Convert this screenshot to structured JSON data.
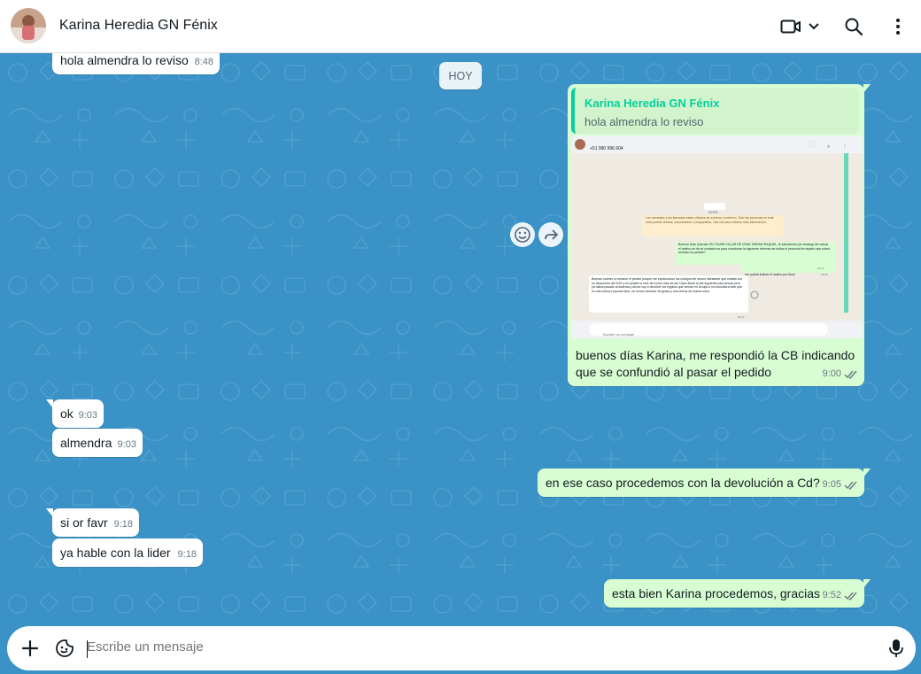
{
  "header": {
    "contact_name": "Karina Heredia GN Fénix",
    "icons": [
      "video-call-icon",
      "chevron-down-icon",
      "search-icon",
      "menu-icon"
    ]
  },
  "chat": {
    "date_chip": "HOY",
    "messages": [
      {
        "dir": "in",
        "text": "hola almendra lo reviso",
        "time": "8:48"
      },
      {
        "dir": "out",
        "quote": {
          "name": "Karina Heredia GN Fénix",
          "text": "hola almendra lo reviso"
        },
        "text_line1": "buenos días Karina, me respondió la CB indicando",
        "text_line2": "que se confundió al pasar el pedido",
        "time": "9:00"
      },
      {
        "dir": "in",
        "text": "ok",
        "time": "9:03"
      },
      {
        "dir": "in",
        "text": "almendra",
        "time": "9:03"
      },
      {
        "dir": "out",
        "text": "en ese caso procedemos con la devolución a Cd?",
        "time": "9:05"
      },
      {
        "dir": "in",
        "text": "si or favr",
        "time": "9:18"
      },
      {
        "dir": "in",
        "text": "ya hable con la lider",
        "time": "9:18"
      },
      {
        "dir": "out",
        "text": "esta bien Karina procedemos, gracias",
        "time": "9:52"
      }
    ]
  },
  "embedded_screenshot": {
    "phone": "+51 990 996 604",
    "date": "AYER",
    "notice": "Los mensajes y las llamadas están cifrados de extremo a extremo. Solo las personas en este chat pueden leerlos, escucharlos o compartirlos. Haz clic para obtener más información.",
    "out1": "Buenos Días Querido GN TOVAR VILLAR DE VIDAL MIRIAM RAQUEL, le saludamos por encargo de natura el motivo es de mi contacto es para corroborar la siguiente informa me indica el personal de reparto que usted rechazo su pedido?",
    "out1_time": "18:02",
    "out2": "me podría indicar el motivo por favor",
    "out2_time": "18:02",
    "in1": "Buenas noches si rechace el pedido porque me equivocaron los códigos del serum hidratante que estaba con un descuento del 40% y mi pedido lo hice de noche más de las 10pm llamé al día siguiente para anular pero ya había pasado al sistema y ahora voy a devolver los regalos que venían en la caja a mi consultora líder que es una crema corporal ekos, un serum reductor de grasa y una crema de manos ekos",
    "in1_time": "22:37",
    "input_placeholder": "Escribe un mensaje"
  },
  "footer": {
    "placeholder": "Escribe un mensaje"
  },
  "colors": {
    "chat_bg": "#3a92c6",
    "outgoing_bubble": "#d9fdd3",
    "incoming_bubble": "#ffffff",
    "accent_green": "#06cf9c",
    "read_tick": "#53bdeb"
  }
}
